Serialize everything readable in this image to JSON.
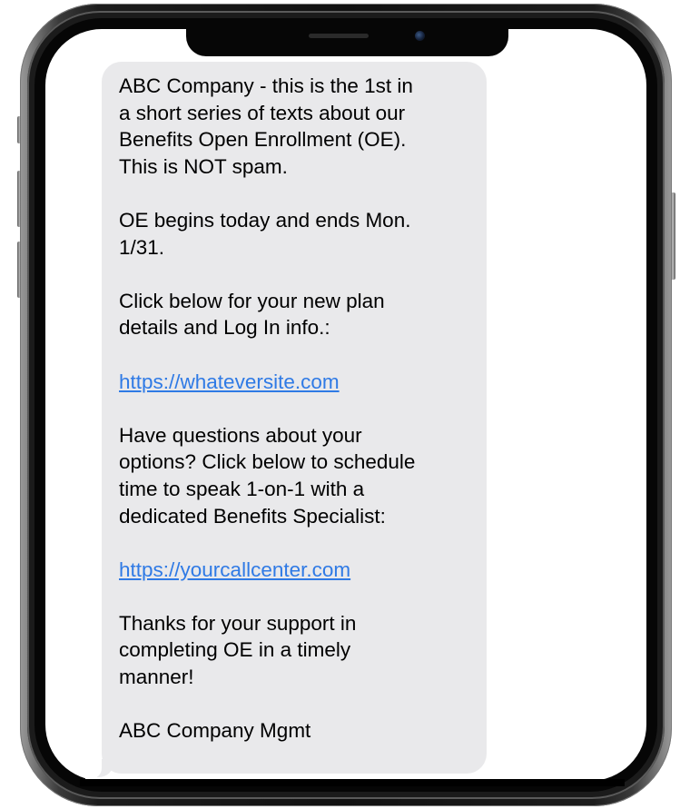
{
  "message": {
    "paragraphs": [
      "ABC Company - this is the 1st in\na short series of texts about our\nBenefits Open Enrollment (OE).\nThis is NOT spam.",
      "OE begins today and ends Mon.\n1/31.",
      "Click below for your new plan\ndetails and Log In info.:"
    ],
    "link1": "https://whateversite.com",
    "paragraphs2": [
      "Have questions about your\noptions? Click below to schedule\ntime to speak 1-on-1 with a\ndedicated Benefits Specialist:"
    ],
    "link2": "https://yourcallcenter.com",
    "paragraphs3": [
      "Thanks for your support in\ncompleting OE in a timely\nmanner!",
      "ABC Company Mgmt"
    ]
  },
  "colors": {
    "bubble": "#e9e9eb",
    "link": "#2f7ae5"
  }
}
